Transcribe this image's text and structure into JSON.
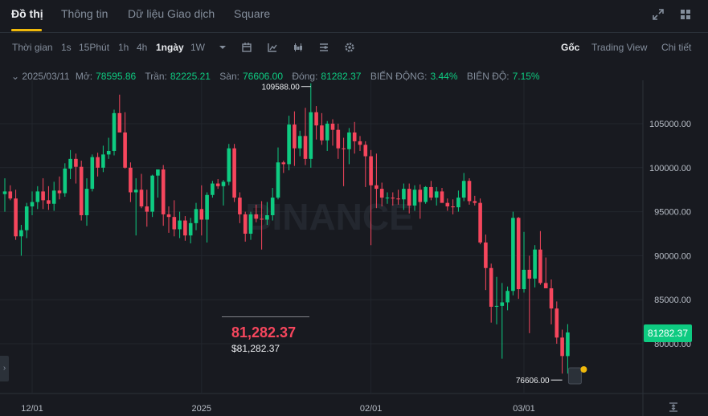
{
  "tabs": [
    {
      "label": "Đồ thị",
      "active": true
    },
    {
      "label": "Thông tin",
      "active": false
    },
    {
      "label": "Dữ liệu Giao dịch",
      "active": false
    },
    {
      "label": "Square",
      "active": false
    }
  ],
  "top_icons": [
    "expand-icon",
    "layout-grid-icon"
  ],
  "toolbar": {
    "time_label": "Thời gian",
    "intervals": [
      "1s",
      "15Phút",
      "1h",
      "4h",
      "1ngày",
      "1W"
    ],
    "active_interval": "1ngày",
    "tool_icons": [
      "calendar-icon",
      "indicator-icon",
      "candle-type-icon",
      "template-icon",
      "settings-icon"
    ],
    "views": [
      "Gốc",
      "Trading View",
      "Chi tiết"
    ],
    "active_view": "Gốc"
  },
  "ohlc": {
    "date": "2025/03/11",
    "open_label": "Mở:",
    "open": "78595.86",
    "high_label": "Trần:",
    "high": "82225.21",
    "low_label": "Sàn:",
    "low": "76606.00",
    "close_label": "Đóng:",
    "close": "81282.37",
    "change_label": "BIẾN ĐỘNG:",
    "change": "3.44%",
    "amplitude_label": "BIÊN ĐỘ:",
    "amplitude": "7.15%"
  },
  "current_price_big": "81,282.37",
  "current_price_small": "$81,282.37",
  "current_price_tag": "81282.37",
  "colors": {
    "up": "#0ecb81",
    "down": "#f6465d",
    "bg": "#181a20",
    "accent": "#f0b90b"
  },
  "chart_data": {
    "type": "candlestick",
    "watermark": "BINANCE",
    "y_ticks": [
      105000,
      100000,
      95000,
      90000,
      85000,
      80000
    ],
    "y_tick_labels": [
      "105000.00",
      "100000.00",
      "95000.00",
      "90000.00",
      "85000.00",
      "80000.00"
    ],
    "x_tick_labels": [
      {
        "label": "12/01",
        "index": 5
      },
      {
        "label": "2025",
        "index": 36
      },
      {
        "label": "02/01",
        "index": 67
      },
      {
        "label": "03/01",
        "index": 95
      }
    ],
    "annotations": {
      "max": "109588.00",
      "min": "76606.00"
    },
    "candles": [
      {
        "o": 97000,
        "h": 98800,
        "l": 95000,
        "c": 97300
      },
      {
        "o": 97300,
        "h": 98000,
        "l": 96300,
        "c": 96500
      },
      {
        "o": 96500,
        "h": 97500,
        "l": 91800,
        "c": 92200
      },
      {
        "o": 92200,
        "h": 93500,
        "l": 90000,
        "c": 92900
      },
      {
        "o": 92900,
        "h": 96000,
        "l": 92000,
        "c": 95600
      },
      {
        "o": 95600,
        "h": 97300,
        "l": 94600,
        "c": 96100
      },
      {
        "o": 96100,
        "h": 97900,
        "l": 95300,
        "c": 97300
      },
      {
        "o": 97300,
        "h": 98800,
        "l": 95300,
        "c": 96300
      },
      {
        "o": 96300,
        "h": 97900,
        "l": 95200,
        "c": 95900
      },
      {
        "o": 95900,
        "h": 98400,
        "l": 95100,
        "c": 97400
      },
      {
        "o": 97400,
        "h": 99000,
        "l": 96400,
        "c": 97100
      },
      {
        "o": 97100,
        "h": 100500,
        "l": 96700,
        "c": 99900
      },
      {
        "o": 99900,
        "h": 102000,
        "l": 98700,
        "c": 101000
      },
      {
        "o": 101000,
        "h": 101600,
        "l": 98200,
        "c": 100100
      },
      {
        "o": 100100,
        "h": 100800,
        "l": 94000,
        "c": 94600
      },
      {
        "o": 94600,
        "h": 98800,
        "l": 93400,
        "c": 97600
      },
      {
        "o": 97600,
        "h": 101500,
        "l": 97300,
        "c": 101200
      },
      {
        "o": 101200,
        "h": 101700,
        "l": 99000,
        "c": 100000
      },
      {
        "o": 100000,
        "h": 102500,
        "l": 99500,
        "c": 101500
      },
      {
        "o": 101500,
        "h": 103400,
        "l": 101000,
        "c": 101900
      },
      {
        "o": 101900,
        "h": 106600,
        "l": 101400,
        "c": 106200
      },
      {
        "o": 106200,
        "h": 108300,
        "l": 105300,
        "c": 104000
      },
      {
        "o": 104000,
        "h": 106300,
        "l": 99900,
        "c": 100000
      },
      {
        "o": 100000,
        "h": 100600,
        "l": 96100,
        "c": 97200
      },
      {
        "o": 97200,
        "h": 98800,
        "l": 92300,
        "c": 97500
      },
      {
        "o": 97500,
        "h": 99300,
        "l": 95400,
        "c": 95600
      },
      {
        "o": 95600,
        "h": 97500,
        "l": 93300,
        "c": 95000
      },
      {
        "o": 95000,
        "h": 99200,
        "l": 94400,
        "c": 99100
      },
      {
        "o": 99100,
        "h": 99800,
        "l": 96600,
        "c": 99800
      },
      {
        "o": 99800,
        "h": 100300,
        "l": 93400,
        "c": 94700
      },
      {
        "o": 94700,
        "h": 95600,
        "l": 92600,
        "c": 94400
      },
      {
        "o": 94400,
        "h": 96300,
        "l": 92200,
        "c": 93000
      },
      {
        "o": 93000,
        "h": 95000,
        "l": 92000,
        "c": 94000
      },
      {
        "o": 94000,
        "h": 94500,
        "l": 91700,
        "c": 92300
      },
      {
        "o": 92300,
        "h": 94300,
        "l": 91400,
        "c": 93700
      },
      {
        "o": 93700,
        "h": 96000,
        "l": 92900,
        "c": 95300
      },
      {
        "o": 95300,
        "h": 98000,
        "l": 92300,
        "c": 94100
      },
      {
        "o": 94100,
        "h": 97200,
        "l": 91500,
        "c": 96900
      },
      {
        "o": 96900,
        "h": 98500,
        "l": 96600,
        "c": 98200
      },
      {
        "o": 98200,
        "h": 98700,
        "l": 97600,
        "c": 97900
      },
      {
        "o": 97900,
        "h": 98600,
        "l": 95700,
        "c": 98400
      },
      {
        "o": 98400,
        "h": 102700,
        "l": 98000,
        "c": 102200
      },
      {
        "o": 102200,
        "h": 102700,
        "l": 96100,
        "c": 96600
      },
      {
        "o": 96600,
        "h": 97200,
        "l": 93700,
        "c": 94700
      },
      {
        "o": 94700,
        "h": 95000,
        "l": 91600,
        "c": 92500
      },
      {
        "o": 92500,
        "h": 95000,
        "l": 91800,
        "c": 94700
      },
      {
        "o": 94700,
        "h": 95800,
        "l": 93800,
        "c": 94200
      },
      {
        "o": 94200,
        "h": 96200,
        "l": 90700,
        "c": 94100
      },
      {
        "o": 94100,
        "h": 96100,
        "l": 93500,
        "c": 94600
      },
      {
        "o": 94600,
        "h": 97700,
        "l": 94000,
        "c": 96600
      },
      {
        "o": 96600,
        "h": 102300,
        "l": 96400,
        "c": 100600
      },
      {
        "o": 100600,
        "h": 100800,
        "l": 99400,
        "c": 100400
      },
      {
        "o": 100400,
        "h": 105900,
        "l": 99700,
        "c": 104900
      },
      {
        "o": 104900,
        "h": 106400,
        "l": 100200,
        "c": 102200
      },
      {
        "o": 102200,
        "h": 104200,
        "l": 101300,
        "c": 103600
      },
      {
        "o": 103600,
        "h": 106800,
        "l": 100300,
        "c": 101000
      },
      {
        "o": 101000,
        "h": 109588,
        "l": 100000,
        "c": 106300
      },
      {
        "o": 106300,
        "h": 107000,
        "l": 103200,
        "c": 104800
      },
      {
        "o": 104800,
        "h": 106200,
        "l": 102600,
        "c": 103100
      },
      {
        "o": 103100,
        "h": 105300,
        "l": 101900,
        "c": 105000
      },
      {
        "o": 105000,
        "h": 105500,
        "l": 102500,
        "c": 104300
      },
      {
        "o": 104300,
        "h": 105000,
        "l": 101000,
        "c": 102200
      },
      {
        "o": 102200,
        "h": 103400,
        "l": 97900,
        "c": 102100
      },
      {
        "o": 102100,
        "h": 104500,
        "l": 100400,
        "c": 104000
      },
      {
        "o": 104000,
        "h": 105200,
        "l": 101600,
        "c": 103000
      },
      {
        "o": 103000,
        "h": 103600,
        "l": 101900,
        "c": 102600
      },
      {
        "o": 102600,
        "h": 103000,
        "l": 97800,
        "c": 101300
      },
      {
        "o": 101300,
        "h": 102000,
        "l": 91200,
        "c": 98000
      },
      {
        "o": 98000,
        "h": 101600,
        "l": 95400,
        "c": 97600
      },
      {
        "o": 97600,
        "h": 98300,
        "l": 95600,
        "c": 96600
      },
      {
        "o": 96600,
        "h": 97200,
        "l": 95900,
        "c": 96600
      },
      {
        "o": 96600,
        "h": 97200,
        "l": 95700,
        "c": 96500
      },
      {
        "o": 96500,
        "h": 97500,
        "l": 95800,
        "c": 96400
      },
      {
        "o": 96400,
        "h": 98200,
        "l": 95200,
        "c": 97600
      },
      {
        "o": 97600,
        "h": 98200,
        "l": 94800,
        "c": 95700
      },
      {
        "o": 95700,
        "h": 98000,
        "l": 95100,
        "c": 97500
      },
      {
        "o": 97500,
        "h": 98100,
        "l": 94200,
        "c": 96100
      },
      {
        "o": 96100,
        "h": 97900,
        "l": 95900,
        "c": 97800
      },
      {
        "o": 97800,
        "h": 98500,
        "l": 96300,
        "c": 96600
      },
      {
        "o": 96600,
        "h": 97800,
        "l": 95700,
        "c": 97300
      },
      {
        "o": 97300,
        "h": 97700,
        "l": 96200,
        "c": 96000
      },
      {
        "o": 96000,
        "h": 96500,
        "l": 95100,
        "c": 95600
      },
      {
        "o": 95600,
        "h": 96400,
        "l": 94700,
        "c": 95500
      },
      {
        "o": 95500,
        "h": 97400,
        "l": 95000,
        "c": 96600
      },
      {
        "o": 96600,
        "h": 99400,
        "l": 96200,
        "c": 98500
      },
      {
        "o": 98500,
        "h": 98800,
        "l": 95800,
        "c": 96200
      },
      {
        "o": 96200,
        "h": 96800,
        "l": 95700,
        "c": 96000
      },
      {
        "o": 96000,
        "h": 96500,
        "l": 91300,
        "c": 91500
      },
      {
        "o": 91500,
        "h": 92400,
        "l": 86100,
        "c": 88600
      },
      {
        "o": 88600,
        "h": 89100,
        "l": 82400,
        "c": 84200
      },
      {
        "o": 84200,
        "h": 87600,
        "l": 82200,
        "c": 84300
      },
      {
        "o": 84300,
        "h": 86900,
        "l": 78300,
        "c": 84700
      },
      {
        "o": 84700,
        "h": 86500,
        "l": 83800,
        "c": 86000
      },
      {
        "o": 86000,
        "h": 95000,
        "l": 85500,
        "c": 94300
      },
      {
        "o": 94300,
        "h": 94400,
        "l": 85100,
        "c": 86200
      },
      {
        "o": 86200,
        "h": 92700,
        "l": 85800,
        "c": 88400
      },
      {
        "o": 88400,
        "h": 90000,
        "l": 81200,
        "c": 87400
      },
      {
        "o": 87400,
        "h": 91200,
        "l": 86400,
        "c": 90700
      },
      {
        "o": 90700,
        "h": 92800,
        "l": 86700,
        "c": 86900
      },
      {
        "o": 86900,
        "h": 89800,
        "l": 86700,
        "c": 86300
      },
      {
        "o": 86300,
        "h": 87300,
        "l": 82200,
        "c": 84000
      },
      {
        "o": 84000,
        "h": 84800,
        "l": 80000,
        "c": 80700
      },
      {
        "o": 80700,
        "h": 81600,
        "l": 76606,
        "c": 78600
      },
      {
        "o": 78595.86,
        "h": 82225.21,
        "l": 76606,
        "c": 81282.37
      }
    ]
  }
}
